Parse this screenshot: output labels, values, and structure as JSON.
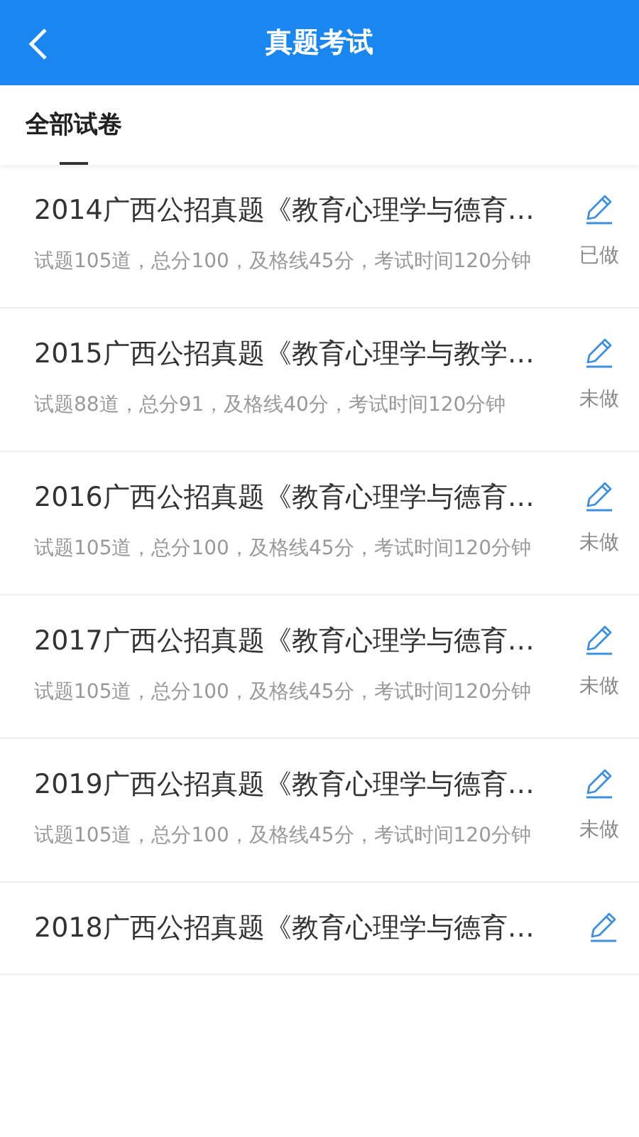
{
  "header": {
    "title": "真题考试"
  },
  "tabs": [
    {
      "label": "全部试卷",
      "selected": true
    }
  ],
  "papers": [
    {
      "title": "2014广西公招真题《教育心理学与德育…",
      "info": "试题105道，总分100，及格线45分，考试时间120分钟",
      "status": "已做"
    },
    {
      "title": "2015广西公招真题《教育心理学与教学…",
      "info": "试题88道，总分91，及格线40分，考试时间120分钟",
      "status": "未做"
    },
    {
      "title": "2016广西公招真题《教育心理学与德育…",
      "info": "试题105道，总分100，及格线45分，考试时间120分钟",
      "status": "未做"
    },
    {
      "title": "2017广西公招真题《教育心理学与德育…",
      "info": "试题105道，总分100，及格线45分，考试时间120分钟",
      "status": "未做"
    },
    {
      "title": "2019广西公招真题《教育心理学与德育…",
      "info": "试题105道，总分100，及格线45分，考试时间120分钟",
      "status": "未做"
    },
    {
      "title": "2018广西公招真题《教育心理学与德育…"
    }
  ]
}
